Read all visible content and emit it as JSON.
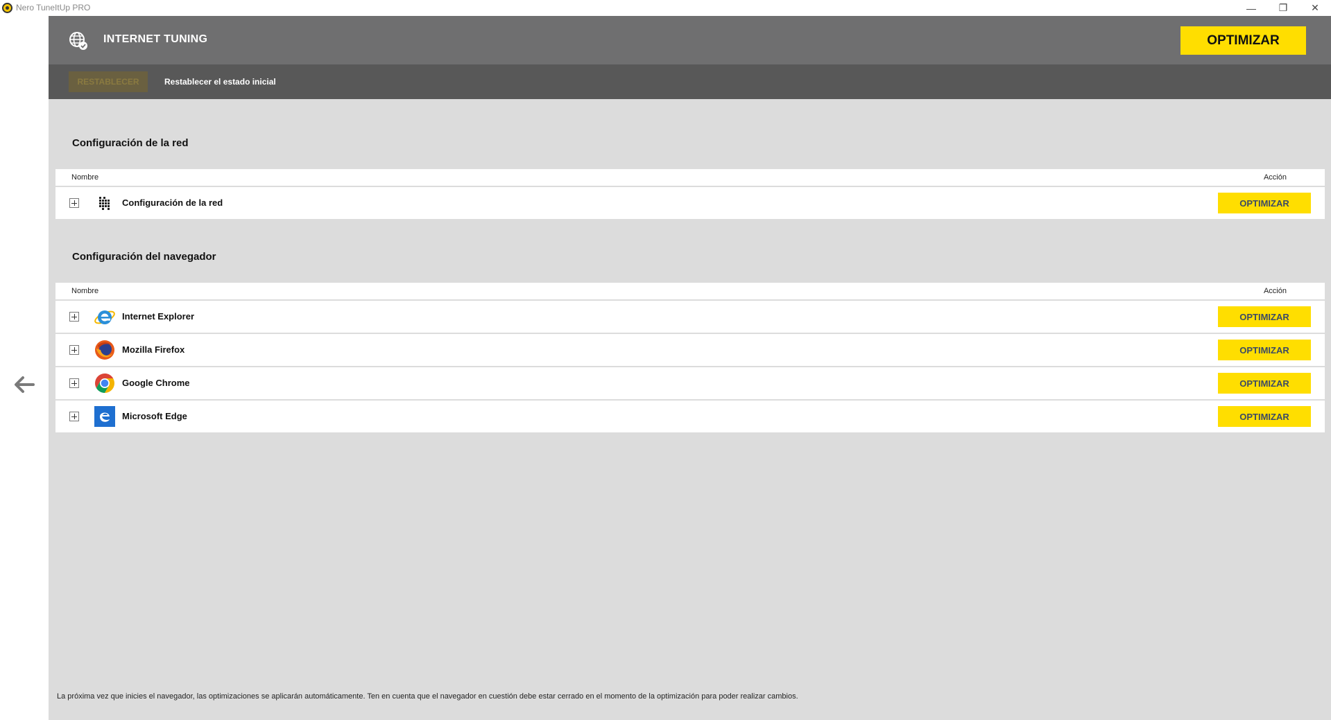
{
  "window": {
    "title": "Nero TuneItUp PRO",
    "controls": [
      "—",
      "❐",
      "✕"
    ]
  },
  "header": {
    "title": "INTERNET TUNING",
    "optimize_all_label": "OPTIMIZAR",
    "accent_color": "#ffde00"
  },
  "subbar": {
    "reset_button_label": "RESTABLECER",
    "reset_description": "Restablecer el estado inicial"
  },
  "sections": [
    {
      "title": "Configuración de la red",
      "col_name": "Nombre",
      "col_action": "Acción",
      "rows": [
        {
          "icon": "network-grid-icon",
          "label": "Configuración de la red",
          "action": "OPTIMIZAR"
        }
      ]
    },
    {
      "title": "Configuración del navegador",
      "col_name": "Nombre",
      "col_action": "Acción",
      "rows": [
        {
          "icon": "internet-explorer-icon",
          "label": "Internet Explorer",
          "action": "OPTIMIZAR"
        },
        {
          "icon": "firefox-icon",
          "label": "Mozilla Firefox",
          "action": "OPTIMIZAR"
        },
        {
          "icon": "chrome-icon",
          "label": "Google Chrome",
          "action": "OPTIMIZAR"
        },
        {
          "icon": "edge-icon",
          "label": "Microsoft Edge",
          "action": "OPTIMIZAR"
        }
      ]
    }
  ],
  "footer": {
    "note": "La próxima vez que inicies el navegador, las optimizaciones se aplicarán automáticamente. Ten en cuenta que el navegador en cuestión debe estar cerrado en el momento de la optimización para poder realizar cambios."
  }
}
